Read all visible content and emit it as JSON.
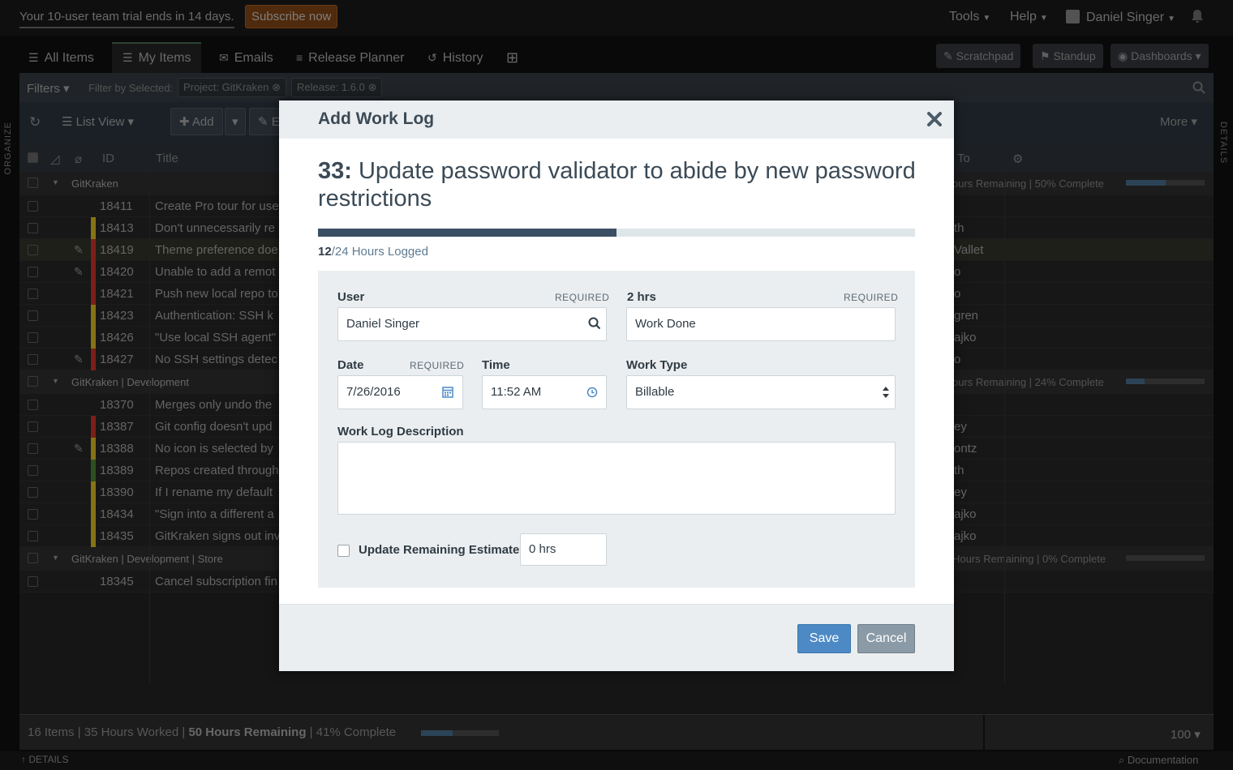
{
  "topbar": {
    "trial_text": "Your 10-user team trial ends in 14 days.",
    "subscribe_label": "Subscribe now",
    "tools_label": "Tools",
    "help_label": "Help",
    "user_name": "Daniel Singer"
  },
  "tabs": [
    {
      "label": "All Items",
      "icon": "list-icon"
    },
    {
      "label": "My Items",
      "icon": "list-icon"
    },
    {
      "label": "Emails",
      "icon": "envelope-icon"
    },
    {
      "label": "Release Planner",
      "icon": "sliders-icon"
    },
    {
      "label": "History",
      "icon": "history-icon"
    }
  ],
  "right_buttons": {
    "scratchpad": "Scratchpad",
    "standup": "Standup",
    "dashboards": "Dashboards"
  },
  "filters": {
    "label": "Filters",
    "filter_by": "Filter by Selected:",
    "chips": [
      "Project: GitKraken",
      "Release: 1.6.0"
    ]
  },
  "toolbar": {
    "list_view": "List View",
    "add": "Add",
    "edit_partial": "E",
    "more": "More"
  },
  "columns": {
    "id": "ID",
    "title": "Title",
    "assigned": "To"
  },
  "side_labels": {
    "left": "ORGANIZE",
    "right": "DETAILS"
  },
  "groups": [
    {
      "name": "GitKraken",
      "status": "ours Remaining | 50% Complete",
      "progress": 0.5,
      "rows": [
        {
          "id": "18411",
          "title": "Create Pro tour for use",
          "assignee": "",
          "priority": "none",
          "attach": false
        },
        {
          "id": "18413",
          "title": "Don't unnecessarily re",
          "assignee": "th",
          "priority": "#b59a1b",
          "attach": false
        },
        {
          "id": "18419",
          "title": "Theme preference doe",
          "assignee": "Vallet",
          "priority": "#a42a22",
          "attach": true,
          "selected": true
        },
        {
          "id": "18420",
          "title": "Unable to add a remot",
          "assignee": "o",
          "priority": "#a42a22",
          "attach": true
        },
        {
          "id": "18421",
          "title": "Push new local repo to",
          "assignee": "o",
          "priority": "#a42a22",
          "attach": false
        },
        {
          "id": "18423",
          "title": "Authentication: SSH k",
          "assignee": "gren",
          "priority": "#b59a1b",
          "attach": false
        },
        {
          "id": "18426",
          "title": "\"Use local SSH agent\" s",
          "assignee": "ajko",
          "priority": "#b59a1b",
          "attach": false
        },
        {
          "id": "18427",
          "title": "No SSH settings detec",
          "assignee": "o",
          "priority": "#a42a22",
          "attach": true
        }
      ]
    },
    {
      "name": "GitKraken | Development",
      "status": "ours Remaining | 24% Complete",
      "progress": 0.24,
      "rows": [
        {
          "id": "18370",
          "title": "Merges only undo the",
          "assignee": "",
          "priority": "none",
          "attach": false
        },
        {
          "id": "18387",
          "title": "Git config doesn't upd",
          "assignee": "ey",
          "priority": "#a42a22",
          "attach": false
        },
        {
          "id": "18388",
          "title": "No icon is selected by",
          "assignee": "ontz",
          "priority": "#b59a1b",
          "attach": true
        },
        {
          "id": "18389",
          "title": "Repos created through",
          "assignee": "th",
          "priority": "#3d6b2a",
          "attach": false
        },
        {
          "id": "18390",
          "title": "If I rename my default",
          "assignee": "ey",
          "priority": "#b59a1b",
          "attach": false
        },
        {
          "id": "18434",
          "title": "\"Sign into a different a",
          "assignee": "ajko",
          "priority": "#b59a1b",
          "attach": false
        },
        {
          "id": "18435",
          "title": "GitKraken signs out inv",
          "assignee": "ajko",
          "priority": "#b59a1b",
          "attach": false
        }
      ]
    },
    {
      "name": "GitKraken | Development | Store",
      "status": "Hours Remaining | 0% Complete",
      "progress": 0,
      "rows": [
        {
          "id": "18345",
          "title": "Cancel subscription fin",
          "assignee": "",
          "priority": "none",
          "attach": false
        }
      ]
    }
  ],
  "footer": {
    "items": "16 Items",
    "worked": "35 Hours Worked",
    "remaining": "50 Hours Remaining",
    "complete": "41% Complete",
    "progress": 0.41,
    "page_size": "100"
  },
  "bottom": {
    "details": "DETAILS",
    "documentation": "Documentation"
  },
  "modal": {
    "title": "Add Work Log",
    "item_number": "33:",
    "item_title": "Update password validator to abide by new password restrictions",
    "hours_logged": "12",
    "hours_total": "/24 Hours Logged",
    "progress": 0.5,
    "user_label": "User",
    "required": "REQUIRED",
    "user_value": "Daniel Singer",
    "hours_label": "2 hrs",
    "work_done_value": "Work Done",
    "date_label": "Date",
    "date_value": "7/26/2016",
    "time_label": "Time",
    "time_value": "11:52 AM",
    "work_type_label": "Work Type",
    "work_type_value": "Billable",
    "description_label": "Work Log Description",
    "description_value": "",
    "update_estimate_label": "Update Remaining Estimate",
    "estimate_value": "0 hrs",
    "save_label": "Save",
    "cancel_label": "Cancel"
  },
  "colors": {
    "accent": "#4d8ac5",
    "progress": "#3b4f62",
    "high_priority": "#a42a22",
    "medium_priority": "#b59a1b",
    "low_priority": "#3d6b2a"
  }
}
